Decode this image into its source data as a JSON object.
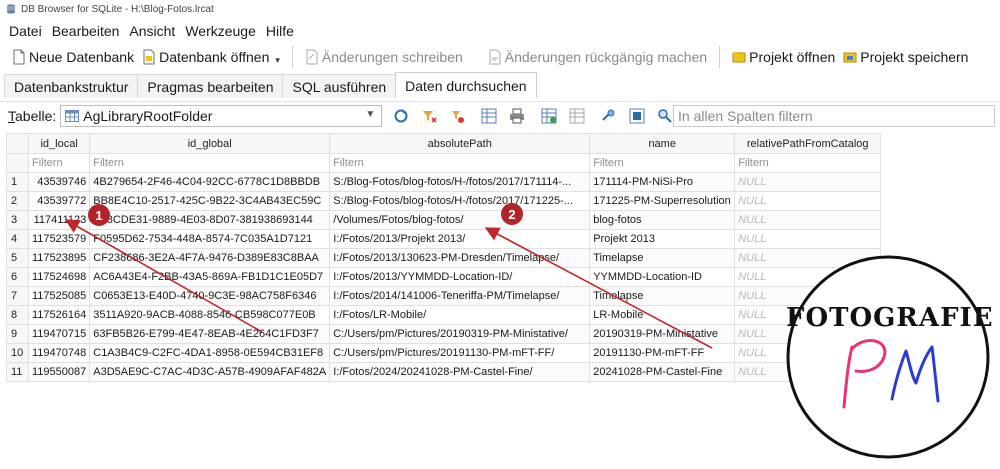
{
  "window": {
    "title": "DB Browser for SQLite - H:\\Blog-Fotos.lrcat"
  },
  "menu": [
    "Datei",
    "Bearbeiten",
    "Ansicht",
    "Werkzeuge",
    "Hilfe"
  ],
  "toolbar": {
    "new_db": "Neue Datenbank",
    "open_db": "Datenbank öffnen",
    "write_changes": "Änderungen schreiben",
    "revert_changes": "Änderungen rückgängig machen",
    "open_project": "Projekt öffnen",
    "save_project": "Projekt speichern"
  },
  "tabs": [
    "Datenbankstruktur",
    "Pragmas bearbeiten",
    "SQL ausführen",
    "Daten durchsuchen"
  ],
  "active_tab": "Daten durchsuchen",
  "browse": {
    "table_label_prefix": "T",
    "table_label_rest": "abelle:",
    "selected_table": "AgLibraryRootFolder",
    "global_filter_placeholder": "In allen Spalten filtern"
  },
  "grid": {
    "columns": [
      "id_local",
      "id_global",
      "absolutePath",
      "name",
      "relativePathFromCatalog"
    ],
    "filter_placeholder": "Filtern",
    "null_text": "NULL",
    "rows": [
      [
        "1",
        "43539746",
        "4B279654-2F46-4C04-92CC-6778C1D8BBDB",
        "S:/Blog-Fotos/blog-fotos/H-/fotos/2017/171114-...",
        "171114-PM-NiSi-Pro"
      ],
      [
        "2",
        "43539772",
        "BB8E4C10-2517-425C-9B22-3C4AB43EC59C",
        "S:/Blog-Fotos/blog-fotos/H-/fotos/2017/171225-...",
        "171225-PM-Superresolution"
      ],
      [
        "3",
        "117411123",
        "E48CDE31-9889-4E03-8D07-381938693144",
        "/Volumes/Fotos/blog-fotos/",
        "blog-fotos"
      ],
      [
        "4",
        "117523579",
        "F0595D62-7534-448A-8574-7C035A1D7121",
        "I:/Fotos/2013/Projekt 2013/",
        "Projekt 2013"
      ],
      [
        "5",
        "117523895",
        "CF238686-3E2A-4F7A-9476-D389E83C8BAA",
        "I:/Fotos/2013/130623-PM-Dresden/Timelapse/",
        "Timelapse"
      ],
      [
        "6",
        "117524698",
        "AC6A43E4-F2BB-43A5-869A-FB1D1C1E05D7",
        "I:/Fotos/2013/YYMMDD-Location-ID/",
        "YYMMDD-Location-ID"
      ],
      [
        "7",
        "117525085",
        "C0653E13-E40D-4740-9C3E-98AC758F6346",
        "I:/Fotos/2014/141006-Teneriffa-PM/Timelapse/",
        "Timelapse"
      ],
      [
        "8",
        "117526164",
        "3511A920-9ACB-4088-8546-CB598C077E0B",
        "I:/Fotos/LR-Mobile/",
        "LR-Mobile"
      ],
      [
        "9",
        "119470715",
        "63FB5B26-E799-4E47-8EAB-4E264C1FD3F7",
        "C:/Users/pm/Pictures/20190319-PM-Ministative/",
        "20190319-PM-Ministative"
      ],
      [
        "10",
        "119470748",
        "C1A3B4C9-C2FC-4DA1-8958-0E594CB31EF8",
        "C:/Users/pm/Pictures/20191130-PM-mFT-FF/",
        "20191130-PM-mFT-FF"
      ],
      [
        "11",
        "119550087",
        "A3D5AE9C-C7AC-4D3C-A57B-4909AFAF482A",
        "I:/Fotos/2024/20241028-PM-Castel-Fine/",
        "20241028-PM-Castel-Fine"
      ]
    ]
  },
  "annotations": {
    "marker1": "1",
    "marker2": "2",
    "color": "#c0272d"
  },
  "logo": {
    "text": "FOTOGRAFIE",
    "monogram": "PM",
    "p_color": "#e8347a",
    "m_color": "#2a3bd6"
  }
}
